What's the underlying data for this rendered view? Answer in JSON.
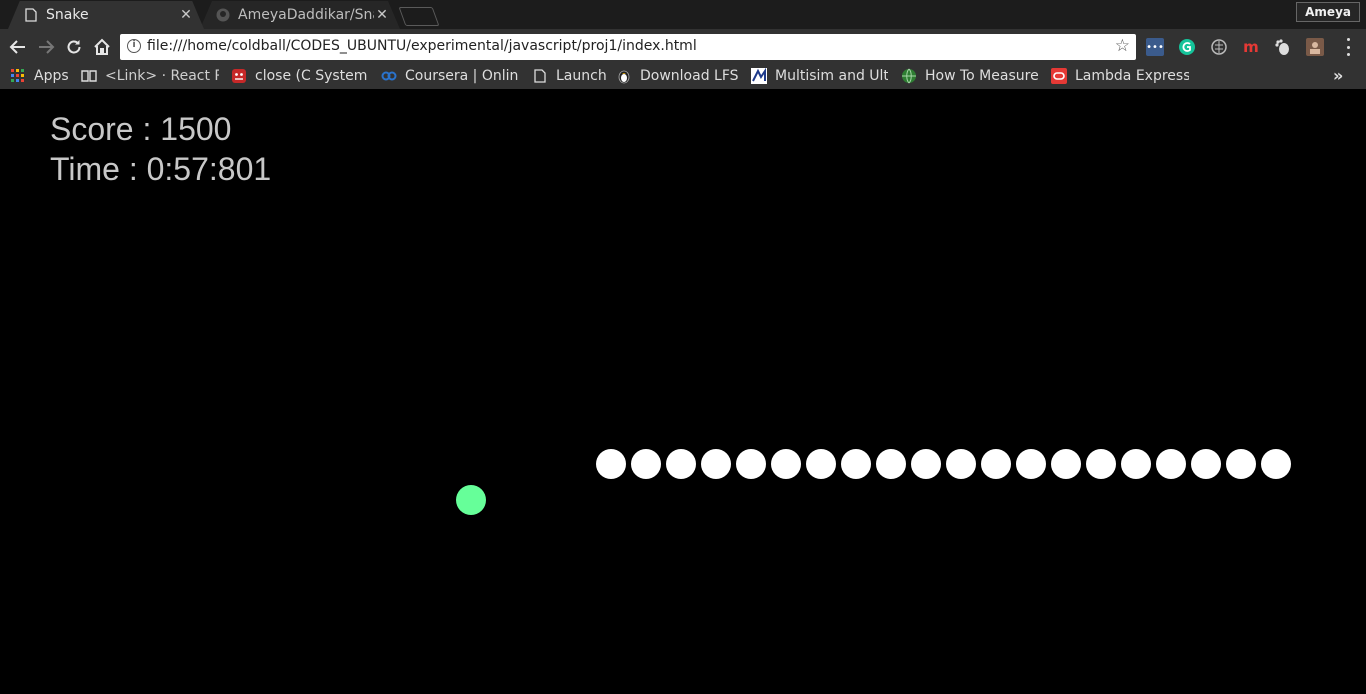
{
  "browser": {
    "tabs": [
      {
        "title": "Snake",
        "active": true,
        "icon": "page-icon"
      },
      {
        "title": "AmeyaDaddikar/Snake",
        "active": false,
        "icon": "github-icon"
      }
    ],
    "profile_name": "Ameya",
    "url": "file:///home/coldball/CODES_UBUNTU/experimental/javascript/proj1/index.html",
    "bookmarks": [
      {
        "label": "Apps",
        "icon": "apps-grid-icon"
      },
      {
        "label": "<Link> · React Router",
        "icon": "book-icon"
      },
      {
        "label": "close (C System Call)",
        "icon": "red-bug-icon"
      },
      {
        "label": "Coursera | Online Courses",
        "icon": "coursera-icon"
      },
      {
        "label": "Launch",
        "icon": "page-icon"
      },
      {
        "label": "Download LFS",
        "icon": "penguin-icon"
      },
      {
        "label": "Multisim and Ultiboard",
        "icon": "ni-icon"
      },
      {
        "label": "How To Measure",
        "icon": "globe-icon"
      },
      {
        "label": "Lambda Expressions",
        "icon": "oracle-icon"
      }
    ]
  },
  "game": {
    "score_label": "Score : 1500",
    "time_label": "Time : 0:57:801",
    "snake_length": 20,
    "colors": {
      "background": "#000000",
      "snake": "#ffffff",
      "food": "#66ff99",
      "hud_text": "#c8c8c8"
    }
  }
}
